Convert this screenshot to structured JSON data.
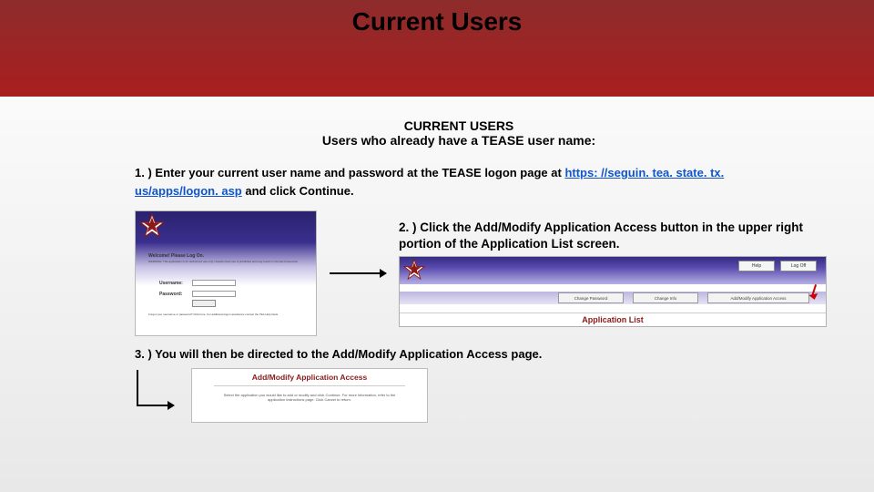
{
  "header": {
    "title": "Current Users"
  },
  "section": {
    "title": "CURRENT USERS",
    "subtitle": "Users who already have a TEASE user name:"
  },
  "steps": {
    "one_prefix": "1. ) Enter your current user name and password at the TEASE logon page at ",
    "one_link_text": "https: //seguin. tea. state. tx. us/apps/logon. asp",
    "one_suffix": " and click Continue.",
    "two": "2. ) Click the Add/Modify Application Access button in the upper right portion of the Application List screen.",
    "three": "3. ) You will then be directed to the Add/Modify Application Access page."
  },
  "shot1": {
    "welcome": "Welcome! Please Log On.",
    "blurb": "WARNING: This application is for authorized use only. Unauthorized use is prohibited and may result in criminal prosecution.",
    "username_label": "Username:",
    "password_label": "Password:",
    "footer": "Forgot your username or password? Click here. For additional logon assistance contact the TEA Help Desk."
  },
  "shot2": {
    "help": "Help",
    "logoff": "Log Off",
    "btn_change_pw": "Change Password",
    "btn_change_info": "Change Info",
    "btn_addmodify": "Add/Modify Application Access",
    "app_list": "Application List"
  },
  "shot3": {
    "title": "Add/Modify Application Access",
    "blurb": "Select the application you would like to add or modify and click Continue. For more information, refer to the application instructions page. Click Cancel to return."
  }
}
